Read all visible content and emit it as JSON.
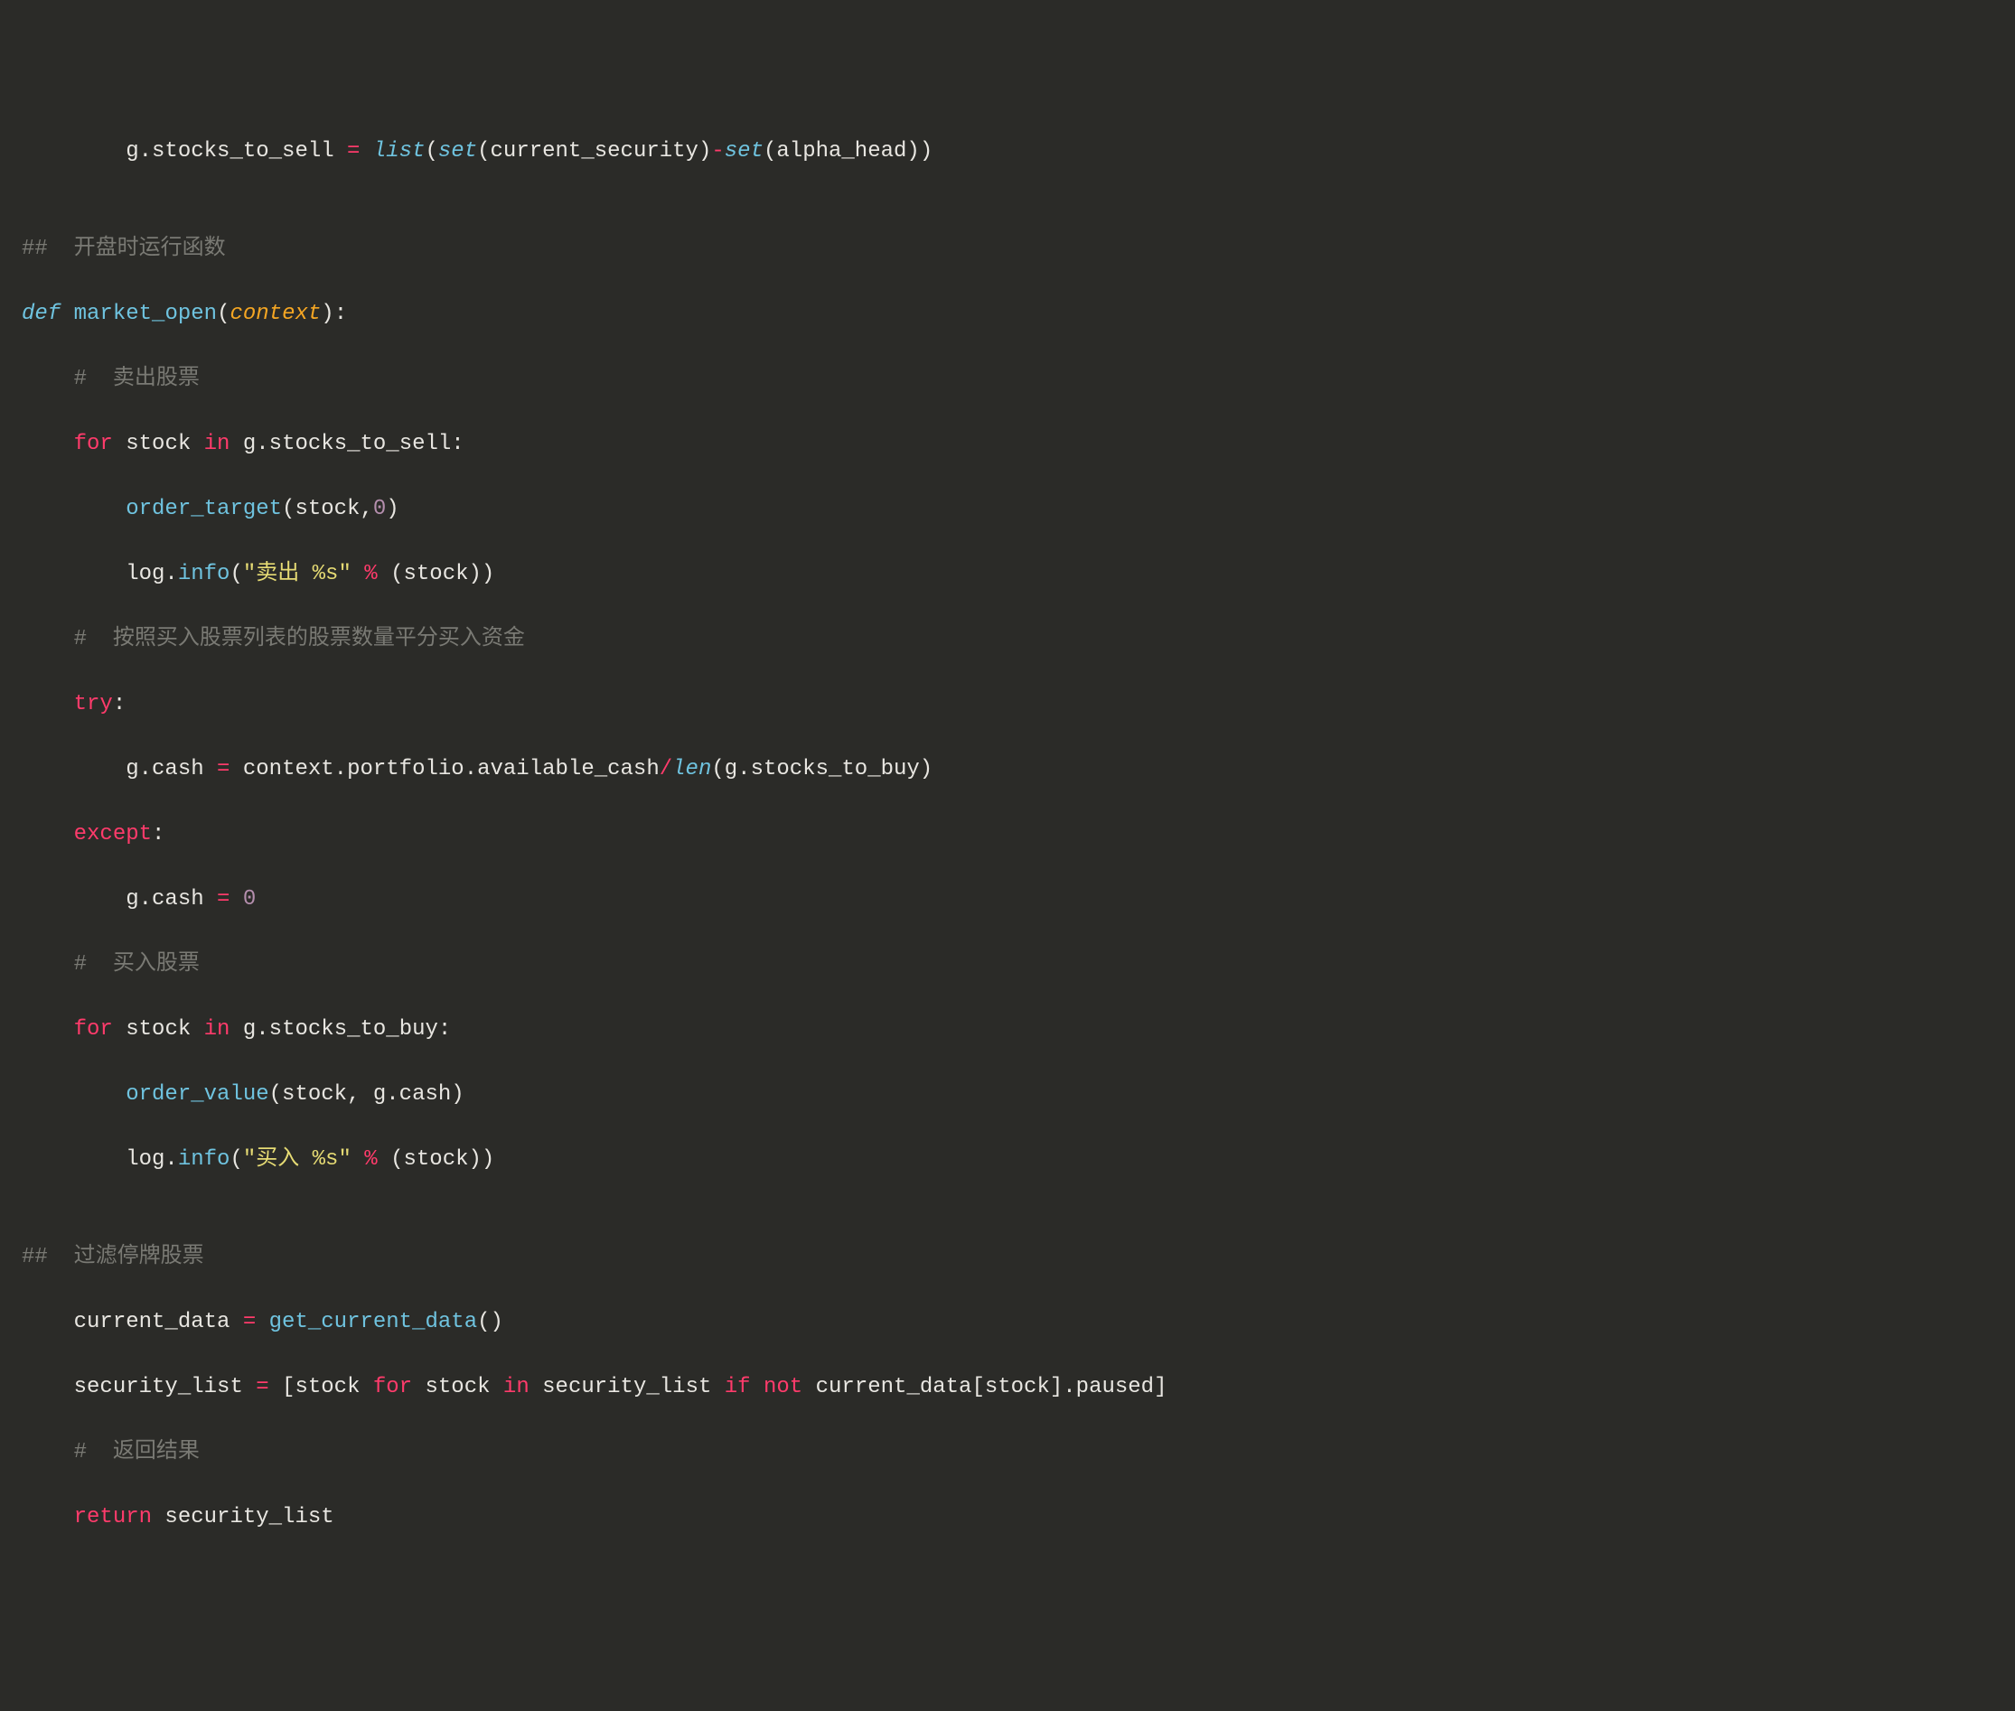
{
  "code": {
    "line1": {
      "indent": "        ",
      "prop": "g.stocks_to_sell",
      "eq": " = ",
      "list": "list",
      "p1": "(",
      "set1": "set",
      "p2": "(current_security)",
      "minus": "-",
      "set2": "set",
      "p3": "(alpha_head))"
    },
    "blank1": "",
    "line3": {
      "text": "##  开盘时运行函数"
    },
    "line4": {
      "def": "def",
      "sp1": " ",
      "fn": "market_open",
      "p1": "(",
      "param": "context",
      "p2": "):"
    },
    "line5": {
      "indent": "    ",
      "text": "#  卖出股票"
    },
    "line6": {
      "indent": "    ",
      "for": "for",
      "sp1": " stock ",
      "in": "in",
      "sp2": " g.stocks_to_sell:"
    },
    "line7": {
      "indent": "        ",
      "fn": "order_target",
      "p1": "(stock,",
      "num": "0",
      "p2": ")"
    },
    "line8": {
      "indent": "        ",
      "obj": "log.",
      "fn": "info",
      "p1": "(",
      "str": "\"卖出 %s\"",
      "op": " % ",
      "p2": "(stock))"
    },
    "line9": {
      "indent": "    ",
      "text": "#  按照买入股票列表的股票数量平分买入资金"
    },
    "line10": {
      "indent": "    ",
      "try": "try",
      "colon": ":"
    },
    "line11": {
      "indent": "        ",
      "lhs": "g.cash ",
      "eq": "=",
      "rhs1": " context.portfolio.available_cash",
      "slash": "/",
      "len": "len",
      "p1": "(g.stocks_to_buy)"
    },
    "line12": {
      "indent": "    ",
      "except": "except",
      "colon": ":"
    },
    "line13": {
      "indent": "        ",
      "lhs": "g.cash ",
      "eq": "=",
      "sp": " ",
      "num": "0"
    },
    "line14": {
      "indent": "    ",
      "text": "#  买入股票"
    },
    "line15": {
      "indent": "    ",
      "for": "for",
      "sp1": " stock ",
      "in": "in",
      "sp2": " g.stocks_to_buy:"
    },
    "line16": {
      "indent": "        ",
      "fn": "order_value",
      "p1": "(stock, g.cash)"
    },
    "line17": {
      "indent": "        ",
      "obj": "log.",
      "fn": "info",
      "p1": "(",
      "str": "\"买入 %s\"",
      "op": " % ",
      "p2": "(stock))"
    },
    "blank2": "",
    "line19": {
      "text": "##  过滤停牌股票"
    },
    "line20": {
      "indent": "    ",
      "lhs": "current_data ",
      "eq": "=",
      "sp": " ",
      "fn": "get_current_data",
      "p1": "()"
    },
    "line21": {
      "indent": "    ",
      "lhs": "security_list ",
      "eq": "=",
      "sp": " [stock ",
      "for": "for",
      "sp2": " stock ",
      "in": "in",
      "sp3": " security_list ",
      "if": "if",
      "sp4": " ",
      "not": "not",
      "sp5": " current_data[stock].paused]"
    },
    "line22": {
      "indent": "    ",
      "text": "#  返回结果"
    },
    "line23": {
      "indent": "    ",
      "ret": "return",
      "sp": " security_list"
    }
  }
}
